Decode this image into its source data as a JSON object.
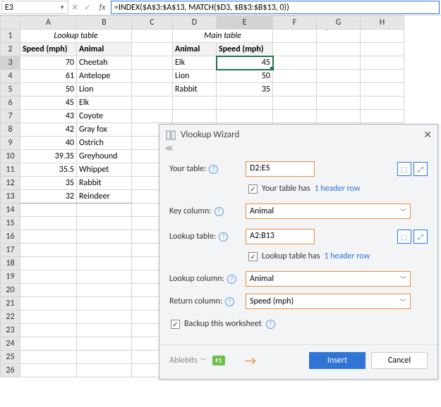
{
  "namebox": "E3",
  "formula": "=INDEX($A$3:$A$13, MATCH($D3, $B$3:$B$13, 0))",
  "cols": [
    "A",
    "B",
    "C",
    "D",
    "E",
    "F",
    "G",
    "H"
  ],
  "lookup_title": "Lookup table",
  "main_title": "Main table",
  "lookup_hdr": {
    "col1": "Speed (mph)",
    "col2": "Animal"
  },
  "main_hdr": {
    "col1": "Animal",
    "col2": "Speed (mph)"
  },
  "lookup_rows": [
    {
      "speed": "70",
      "animal": "Cheetah"
    },
    {
      "speed": "61",
      "animal": "Antelope"
    },
    {
      "speed": "50",
      "animal": "Lion"
    },
    {
      "speed": "45",
      "animal": "Elk"
    },
    {
      "speed": "43",
      "animal": "Coyote"
    },
    {
      "speed": "42",
      "animal": "Gray fox"
    },
    {
      "speed": "40",
      "animal": "Ostrich"
    },
    {
      "speed": "39.35",
      "animal": "Greyhound"
    },
    {
      "speed": "35.5",
      "animal": "Whippet"
    },
    {
      "speed": "35",
      "animal": "Rabbit"
    },
    {
      "speed": "32",
      "animal": "Reindeer"
    }
  ],
  "main_rows": [
    {
      "animal": "Elk",
      "speed": "45"
    },
    {
      "animal": "Lion",
      "speed": "50"
    },
    {
      "animal": "Rabbit",
      "speed": "35"
    }
  ],
  "wizard": {
    "title": "Vlookup Wizard",
    "labels": {
      "your_table": "Your table:",
      "key_column": "Key column:",
      "lookup_table": "Lookup table:",
      "lookup_column": "Lookup column:",
      "return_column": "Return column:"
    },
    "values": {
      "your_table": "D2:E5",
      "key_column": "Animal",
      "lookup_table": "A2:B13",
      "lookup_column": "Animal",
      "return_column": "Speed (mph)"
    },
    "chk1_text": "Your table has",
    "chk1_link": "1 header row",
    "chk2_text": "Lookup table has",
    "chk2_link": "1 header row",
    "backup": "Backup this worksheet",
    "brand": "Ablebits",
    "insert": "Insert",
    "cancel": "Cancel"
  }
}
